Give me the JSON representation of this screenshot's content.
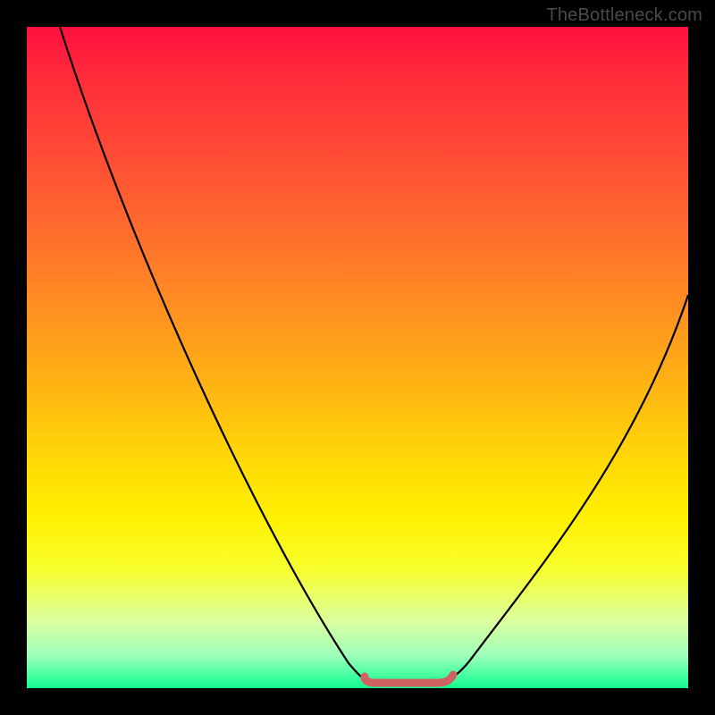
{
  "watermark": "TheBottleneck.com",
  "colors": {
    "frame": "#000000",
    "gradient_top": "#ff0f3d",
    "gradient_bottom": "#15f68f",
    "curve": "#000000",
    "flat_segment": "#d46a6a"
  },
  "chart_data": {
    "type": "line",
    "title": "",
    "xlabel": "",
    "ylabel": "",
    "xlim": [
      0,
      100
    ],
    "ylim": [
      0,
      100
    ],
    "series": [
      {
        "name": "curve",
        "x": [
          5,
          10,
          15,
          20,
          25,
          30,
          35,
          40,
          45,
          50,
          52,
          55,
          58,
          60,
          63,
          65,
          68,
          72,
          76,
          80,
          84,
          88,
          92,
          96,
          100
        ],
        "y": [
          100,
          90,
          80,
          70,
          59,
          48,
          37,
          26,
          16,
          7,
          4,
          1.5,
          0.8,
          0.8,
          0.8,
          1.5,
          5,
          12,
          20,
          28,
          36,
          44,
          50,
          56,
          60
        ]
      },
      {
        "name": "flat-min-segment",
        "x": [
          52,
          63
        ],
        "y": [
          1.2,
          1.2
        ]
      }
    ],
    "annotations": []
  }
}
